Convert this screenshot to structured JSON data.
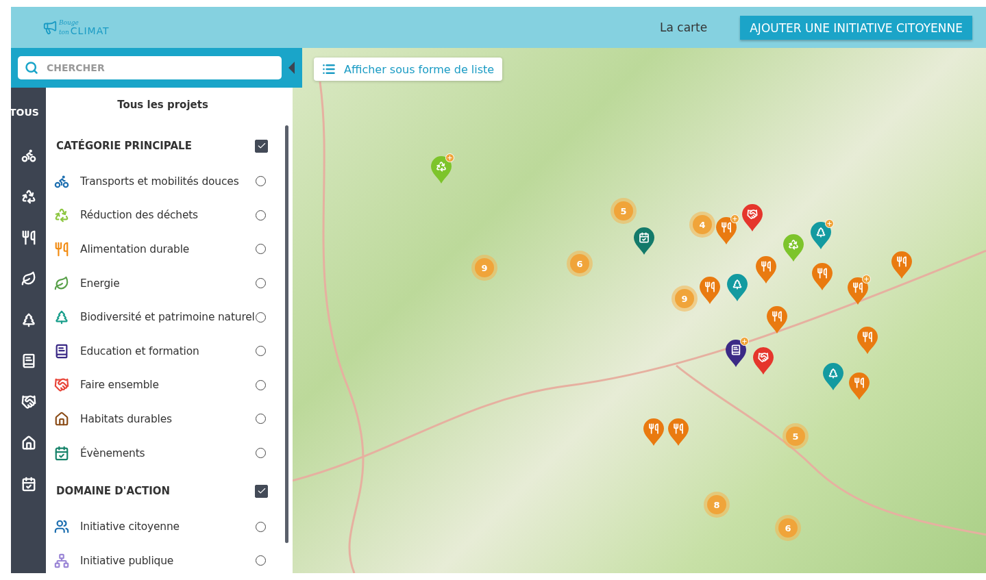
{
  "header": {
    "logo": {
      "line1": "Bouge",
      "line2": "ton",
      "line3": "CLIMAT"
    },
    "nav_link": "La carte",
    "cta_button": "AJOUTER UNE INITIATIVE CITOYENNE"
  },
  "search": {
    "placeholder": "CHERCHER"
  },
  "sidebar": {
    "tabs": [
      {
        "kind": "all",
        "label": "TOUS"
      },
      {
        "kind": "bike"
      },
      {
        "kind": "recycle"
      },
      {
        "kind": "food"
      },
      {
        "kind": "leaf"
      },
      {
        "kind": "tree"
      },
      {
        "kind": "book"
      },
      {
        "kind": "handshake"
      },
      {
        "kind": "house"
      },
      {
        "kind": "event"
      }
    ]
  },
  "filters": {
    "title": "Tous les projets",
    "sections": [
      {
        "title": "CATÉGORIE PRINCIPALE",
        "checked": true,
        "items": [
          {
            "kind": "bike",
            "label": "Transports et mobilités douces",
            "selected": false
          },
          {
            "kind": "recycle",
            "label": "Réduction des déchets",
            "selected": false
          },
          {
            "kind": "food",
            "label": "Alimentation durable",
            "selected": false
          },
          {
            "kind": "leaf",
            "label": "Energie",
            "selected": false
          },
          {
            "kind": "tree",
            "label": "Biodiversité et patrimoine naturel",
            "selected": false
          },
          {
            "kind": "book",
            "label": "Education et formation",
            "selected": false
          },
          {
            "kind": "handshake",
            "label": "Faire ensemble",
            "selected": false
          },
          {
            "kind": "house",
            "label": "Habitats durables",
            "selected": false
          },
          {
            "kind": "event",
            "label": "Évènements",
            "selected": false
          }
        ]
      },
      {
        "title": "DOMAINE D'ACTION",
        "checked": true,
        "items": [
          {
            "kind": "users",
            "label": "Initiative citoyenne",
            "selected": false
          },
          {
            "kind": "network",
            "label": "Initiative publique",
            "selected": false
          }
        ]
      }
    ]
  },
  "map": {
    "list_button": "Afficher sous forme de liste",
    "clusters": [
      "5",
      "4",
      "9",
      "6",
      "9",
      "5",
      "8",
      "6"
    ],
    "pins": [
      {
        "kind": "recycle",
        "plus": true
      },
      {
        "kind": "event",
        "plus": false
      },
      {
        "kind": "food",
        "plus": true
      },
      {
        "kind": "handshake",
        "plus": false
      },
      {
        "kind": "recycle",
        "plus": false
      },
      {
        "kind": "tree",
        "plus": true
      },
      {
        "kind": "food",
        "plus": false
      },
      {
        "kind": "food",
        "plus": true
      },
      {
        "kind": "food",
        "plus": false
      },
      {
        "kind": "tree",
        "plus": false
      },
      {
        "kind": "food",
        "plus": false
      },
      {
        "kind": "food",
        "plus": false
      },
      {
        "kind": "food",
        "plus": false
      },
      {
        "kind": "book",
        "plus": true
      },
      {
        "kind": "handshake",
        "plus": false
      },
      {
        "kind": "food",
        "plus": false
      },
      {
        "kind": "tree",
        "plus": false
      },
      {
        "kind": "food",
        "plus": false
      },
      {
        "kind": "food",
        "plus": false
      },
      {
        "kind": "food",
        "plus": false
      }
    ]
  }
}
